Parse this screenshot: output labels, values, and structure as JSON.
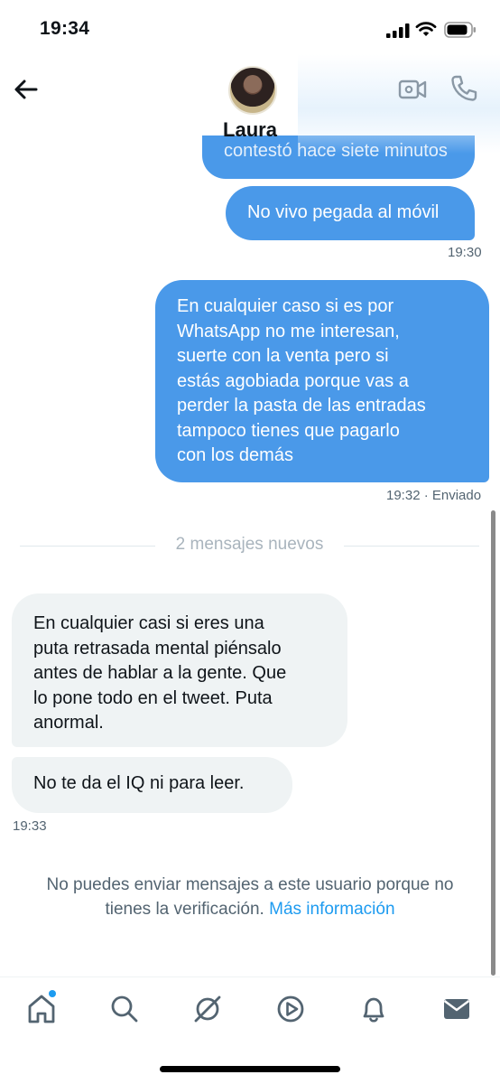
{
  "status_bar": {
    "time": "19:34"
  },
  "header": {
    "contact_name": "Laura"
  },
  "messages": {
    "partial_text": "contestó hace siete minutos",
    "sent_1": {
      "text": "No vivo pegada al móvil",
      "time": "19:30"
    },
    "sent_2": {
      "lines": [
        "En cualquier caso si es por",
        "WhatsApp no me interesan,",
        "suerte con la venta pero si",
        "estás agobiada porque vas a",
        "perder la pasta de las entradas",
        "tampoco tienes que pagarlo",
        "con los demás"
      ],
      "time": "19:32 · Enviado"
    },
    "divider": "2 mensajes nuevos",
    "recv_1": {
      "lines": [
        "En cualquier casi si eres una",
        "puta retrasada mental piénsalo",
        "antes de hablar a la gente. Que",
        "lo pone todo en el tweet. Puta",
        "anormal."
      ]
    },
    "recv_2": {
      "text": "No te da el IQ ni para leer.",
      "time": "19:33"
    }
  },
  "notice": {
    "line1": "No puedes enviar mensajes a este usuario porque no",
    "line2": "tienes la verificación.",
    "link": "Más información"
  },
  "tabs": [
    "home-icon",
    "search-icon",
    "grok-icon",
    "video-icon",
    "notifications-icon",
    "messages-icon"
  ],
  "colors": {
    "sent_bubble": "#4a99e9",
    "received_bubble": "#eff3f4",
    "accent": "#1d9bf0",
    "muted_text": "#536471"
  }
}
